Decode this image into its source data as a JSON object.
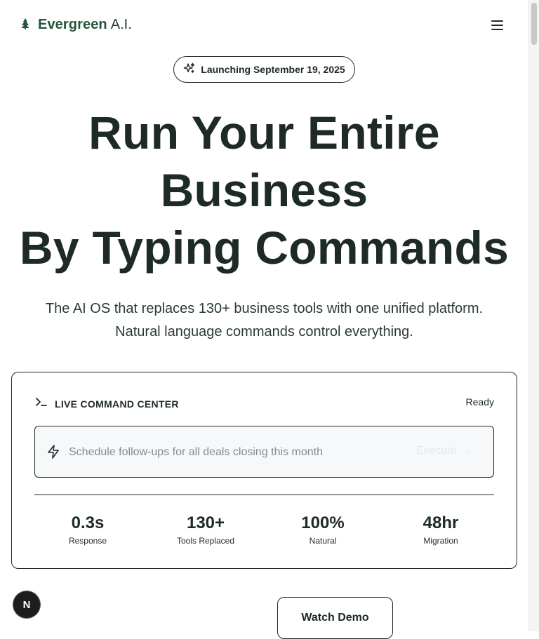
{
  "brand": {
    "name": "Evergreen",
    "suffix": "A.I."
  },
  "badge": {
    "label": "Launching September 19, 2025"
  },
  "hero": {
    "line1": "Run Your Entire",
    "line2": "Business",
    "line3": "By Typing Commands"
  },
  "subtitle": {
    "line1": "The AI OS that replaces 130+ business tools with one unified platform.",
    "line2": "Natural language commands control everything."
  },
  "command_center": {
    "title": "LIVE COMMAND CENTER",
    "status": "Ready",
    "placeholder": "Schedule follow-ups for all deals closing this month",
    "execute_label": "Execute →",
    "stats": [
      {
        "value": "0.3s",
        "label": "Response"
      },
      {
        "value": "130+",
        "label": "Tools Replaced"
      },
      {
        "value": "100%",
        "label": "Natural"
      },
      {
        "value": "48hr",
        "label": "Migration"
      }
    ]
  },
  "cta": {
    "watch_demo": "Watch Demo"
  },
  "dev_badge": {
    "letter": "N"
  },
  "colors": {
    "brand_green": "#24553a",
    "text": "#1e2a28"
  }
}
